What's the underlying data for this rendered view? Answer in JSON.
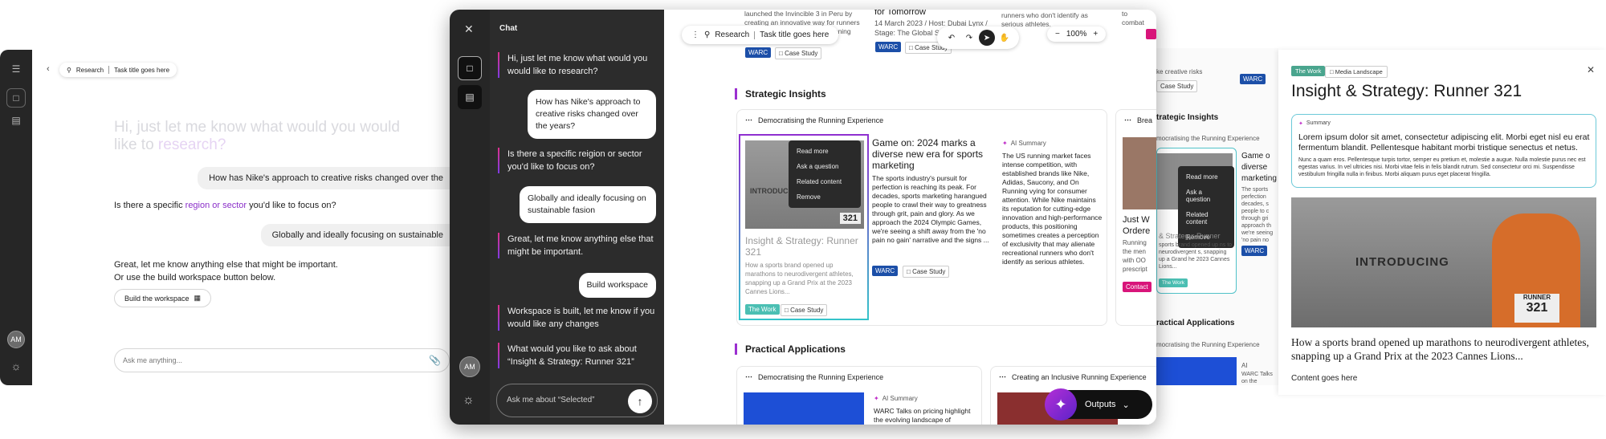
{
  "screen1": {
    "breadcrumb": {
      "section": "Research",
      "title": "Task title goes here"
    },
    "ghost_line1": "Hi, just let me know what would you would",
    "ghost_line2a": "like to ",
    "ghost_line2b": "research?",
    "user_msg_1": "How has Nike's approach to creative risks changed over the",
    "bot_msg_2_pre": "Is there a specific ",
    "bot_msg_2_link": "region or sector",
    "bot_msg_2_post": " you'd like to focus on?",
    "user_msg_2": "Globally and ideally focusing on sustainable",
    "bot_msg_3_l1": "Great, let me know anything else that might be important.",
    "bot_msg_3_l2": "Or use the build workspace button below.",
    "build_button": "Build the workspace",
    "input_placeholder": "Ask me anything...",
    "avatar": "AM"
  },
  "screen2": {
    "chat_title": "Chat",
    "avatar": "AM",
    "messages": {
      "bot1": "Hi, just let me know what would you would like to research?",
      "user1": "How has Nike's approach to creative risks changed over the years?",
      "bot2": "Is there a specific reigion or sector you'd like to focus on?",
      "user2": "Globally and ideally focusing on sustainable fasion",
      "bot3": "Great, let me know anything else that might be important.",
      "user3": "Build workspace",
      "bot4": "Workspace is built, let me know if you would like any changes",
      "bot5": "What would you like to ask about “Insight & Strategy: Runner 321”"
    },
    "chat_input_placeholder": "Ask me about “Selected”",
    "toolbar": {
      "section": "Research",
      "title": "Task title goes here",
      "zoom": "100%"
    },
    "top_cards": {
      "c1_text_l1": "launched the Invincible 3 in Peru by",
      "c1_text_l2": "creating an innovative way for runners",
      "c1_text_l3": "cushioning",
      "c2_title": "for Tomorrow",
      "c2_meta_l1": "14 March 2023 / Host: Dubai Lynx /",
      "c2_meta_l2": "Stage: The Global Stage",
      "c3_text": "runners who don't identify as serious athletes.",
      "c4_text_l1": "to",
      "c4_text_l2": "combat"
    },
    "tags": {
      "warc": "WARC",
      "case": "Case Study",
      "work": "The Work",
      "contact": "Contact"
    },
    "strategic_title": "Strategic Insights",
    "practical_title": "Practical Applications",
    "group1_head": "Democratising the Running Experience",
    "group2_head": "Creating an Inclusive Running Experience",
    "group_b_head": "Brea",
    "menu": [
      "Read more",
      "Ask a question",
      "Related content",
      "Remove"
    ],
    "card_a": {
      "title": "Insight & Strategy: Runner 321",
      "body": "How a sports brand opened up marathons to neurodivergent athletes, snapping up a Grand Prix at the 2023 Cannes Lions...",
      "thumb_word": "INTRODUCING",
      "bib": "321"
    },
    "card_b": {
      "title": "Game on: 2024 marks a diverse new era for sports marketing",
      "body": "The sports industry's pursuit for perfection is reaching its peak. For decades, sports marketing harangued people to crawl their way to greatness through grit, pain and glory. As we approach the 2024 Olympic Games, we're seeing a shift away from the 'no pain no gain' narrative and the signs ..."
    },
    "card_c": {
      "label": "AI Summary",
      "body": "The US running market faces intense competition, with established brands like Nike, Adidas, Saucony, and On Running vying for consumer attention. While Nike maintains its reputation for cutting-edge innovation and high-performance products, this positioning sometimes creates a perception of exclusivity that may alienate recreational runners who don't identify as serious athletes."
    },
    "card_d": {
      "title_l1": "Just W",
      "title_l2": "Ordere",
      "body": "Running the men with OO prescript"
    },
    "practical_ai": {
      "label": "AI Summary",
      "body_l1": "WARC Talks on pricing highlight",
      "body_l2": "the evolving landscape of"
    },
    "outputs": "Outputs"
  },
  "screen3": {
    "top_tag": "WARC",
    "top_text": "ke creative risks",
    "case": "Case Study",
    "section": "trategic Insights",
    "group": "mocratising the Running Experience",
    "menu": [
      "Read more",
      "Ask a question",
      "Related content",
      "Remove"
    ],
    "card_title": "& Strategy: Runner",
    "card_body": "sports brand opened up ns to neurodivergent s, snapping up a Grand he 2023 Cannes Lions...",
    "card2_title_l1": "Game o",
    "card2_title_l2": "diverse",
    "card2_title_l3": "marketing",
    "card2_body": "The sports perfection decades, s people to c through gri approach th we're seeing 'no pain no",
    "practical": "ractical Applications",
    "group2": "mocratising the Running Experience",
    "ai_label": "AI",
    "ai_body": "WARC Talks on the evolving la"
  },
  "screen4": {
    "tag_work": "The Work",
    "tag_media": "Media Landscape",
    "title": "Insight & Strategy: Runner 321",
    "summary_label": "Summary",
    "summary_lead": "Lorem ipsum dolor sit amet, consectetur adipiscing elit. Morbi eget nisl eu erat fermentum blandit. Pellentesque habitant morbi tristique senectus et netus.",
    "summary_small": "Nunc a quam eros. Pellentesque turpis tortor, semper eu pretium et, molestie a augue. Nulla molestie purus nec est egestas varius. In vel ultricies nisi. Morbi vitae felis in felis blandit rutrum. Sed consectetur orci mi. Suspendisse vestibulum fringilla nulla in finibus. Morbi aliquam purus eget placerat fringilla.",
    "hero_word": "INTRODUCING",
    "bib_label": "RUNNER",
    "bib_num": "321",
    "headline": "How a sports brand opened up marathons to neurodivergent athletes, snapping up a Grand Prix at the 2023 Cannes Lions...",
    "content": "Content goes here"
  }
}
